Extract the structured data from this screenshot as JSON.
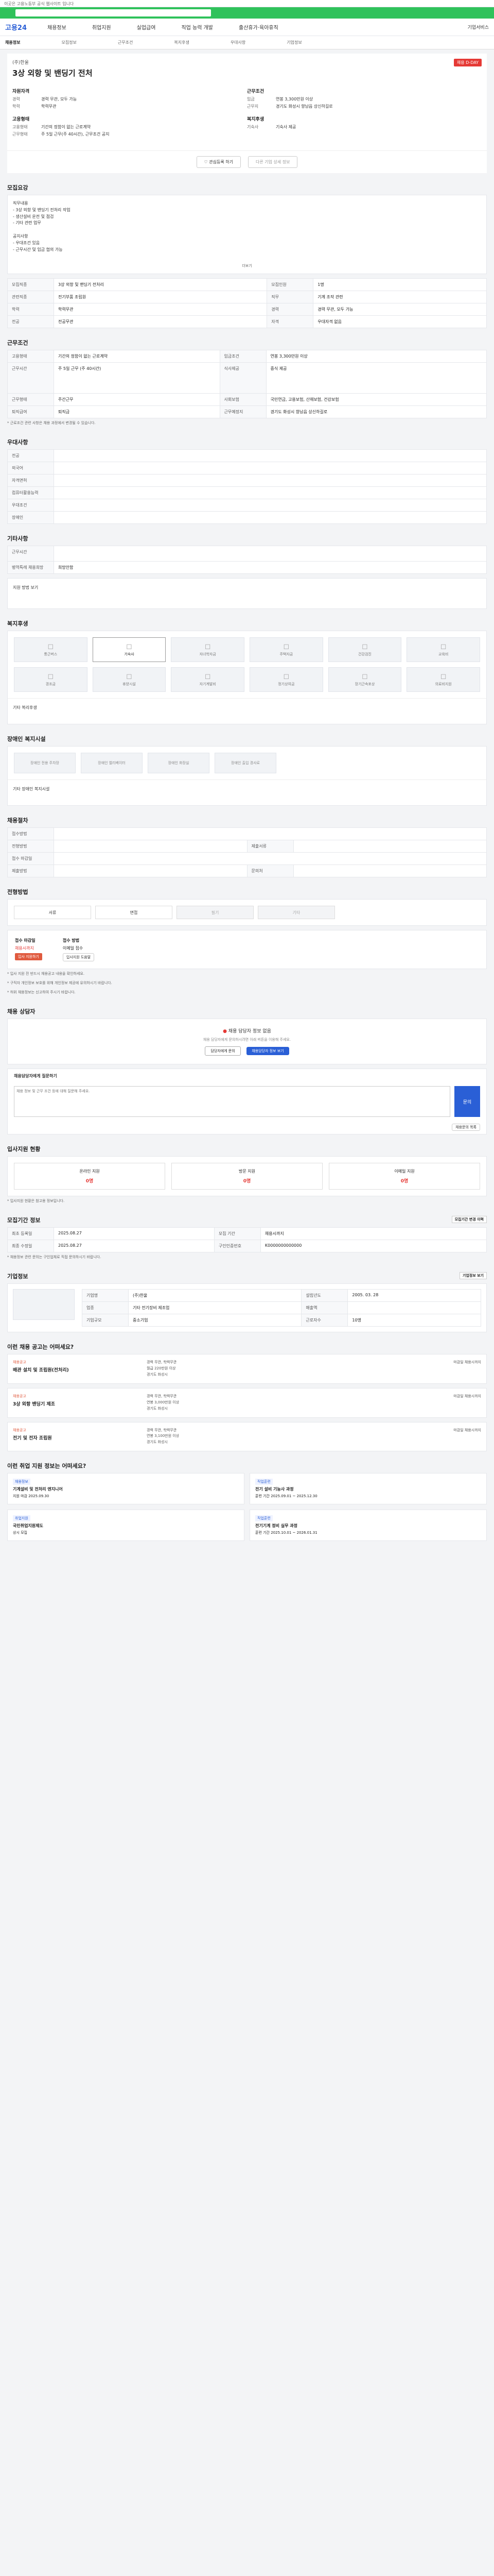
{
  "top": {
    "notice": "이곳은 고용노동부 공식 웹사이트 입니다"
  },
  "gnb": {
    "logo": "고용24",
    "menu": [
      "채용정보",
      "취업지원",
      "실업급여",
      "직업 능력 개발",
      "출산휴가·육아휴직"
    ],
    "right": "기업서비스"
  },
  "subnav": [
    "채용정보",
    "모집정보",
    "근무조건",
    "복지후생",
    "우대사항",
    "기업정보"
  ],
  "headline": {
    "company": "(주)한울",
    "title": "3상 외항 및 밴딩기 전처",
    "badge": "채용 D-DAY"
  },
  "summary": {
    "left": [
      {
        "group": "자원자격",
        "rows": [
          {
            "k": "경력",
            "v": "경력 무관, 모두 가능"
          },
          {
            "k": "학력",
            "v": "학력무관"
          }
        ]
      },
      {
        "group": "고용형태",
        "rows": [
          {
            "k": "고용형태",
            "v": "기간의 정함이 없는 근로계약"
          },
          {
            "k": "근무형태",
            "v": "주 5일 근무(주 40시간), 근무조건 공지"
          }
        ]
      }
    ],
    "right": [
      {
        "group": "근무조건",
        "rows": [
          {
            "k": "임금",
            "v": "연봉 3,300만원 이상"
          },
          {
            "k": "근무지",
            "v": "경기도 화성시 향남읍 상신하길로"
          }
        ]
      },
      {
        "group": "복지후생",
        "rows": [
          {
            "k": "기숙사",
            "v": "기숙사 제공"
          }
        ]
      }
    ],
    "save_btn": "관심등록 하기",
    "share_btn": "다른 기업 상세 정보"
  },
  "recruit": {
    "title": "모집요강",
    "desc_lines": [
      "직무내용",
      "- 3상 외항 및 밴딩기 전처리 작업",
      "- 생산설비 운전 및 점검",
      "- 기타 관련 업무",
      "",
      "공지사항",
      "- 우대조건 있음",
      "- 근무시간 및 임금 협의 가능"
    ],
    "more": "더보기",
    "table": [
      [
        {
          "h": "모집직종"
        },
        {
          "v": "3상 외항 및 밴딩기 전처리"
        },
        {
          "h": "모집인원"
        },
        {
          "v": "1명"
        }
      ],
      [
        {
          "h": "관련직종"
        },
        {
          "v": "전기부품 조립원"
        },
        {
          "h": "직무"
        },
        {
          "v": "기계 조작 관련"
        }
      ],
      [
        {
          "h": "학력"
        },
        {
          "v": "학력무관"
        },
        {
          "h": "경력"
        },
        {
          "v": "경력 무관, 모두 가능"
        }
      ],
      [
        {
          "h": "전공"
        },
        {
          "v": "전공무관"
        },
        {
          "h": "자격"
        },
        {
          "v": "우대자격 없음"
        }
      ]
    ]
  },
  "conditions": {
    "title": "근무조건",
    "rows": [
      [
        {
          "h": "고용형태"
        },
        {
          "v": "기간의 정함이 없는 근로계약"
        },
        {
          "h": "임금조건"
        },
        {
          "v": "연봉 3,300만원 이상"
        }
      ],
      [
        {
          "h": "근무시간"
        },
        {
          "v": "주 5일 근무 (주 40시간)"
        },
        {
          "h": "식사제공"
        },
        {
          "v": "중식 제공"
        }
      ],
      [
        {
          "h": "근무형태"
        },
        {
          "v": "주간근무"
        },
        {
          "h": "사회보험"
        },
        {
          "v": "국민연금, 고용보험, 산재보험, 건강보험"
        }
      ],
      [
        {
          "h": "퇴직급여"
        },
        {
          "v": "퇴직금"
        },
        {
          "h": "근무예정지"
        },
        {
          "v": "경기도 화성시 향남읍 상신하길로"
        }
      ]
    ],
    "note": "* 근로조건 관련 사항은 채용 과정에서 변경될 수 있습니다."
  },
  "prefer": {
    "title": "우대사항",
    "rows": [
      [
        {
          "h": "전공"
        },
        {
          "v": ""
        }
      ],
      [
        {
          "h": "외국어"
        },
        {
          "v": ""
        }
      ],
      [
        {
          "h": "자격면허"
        },
        {
          "v": ""
        }
      ],
      [
        {
          "h": "컴퓨터활용능력"
        },
        {
          "v": ""
        }
      ],
      [
        {
          "h": "우대조건"
        },
        {
          "v": ""
        }
      ],
      [
        {
          "h": "장애인"
        },
        {
          "v": ""
        }
      ]
    ]
  },
  "extra": {
    "title": "기타사항",
    "rows": [
      [
        {
          "h": "근무시간"
        },
        {
          "v": ""
        }
      ],
      [
        {
          "h": "병역특례 채용희망"
        },
        {
          "v": "희망안함"
        }
      ]
    ],
    "link": "지원 방법 보기"
  },
  "welfare": {
    "title": "복지후생",
    "items": [
      "통근버스",
      "기숙사",
      "자녀학자금",
      "주택자금",
      "건강검진",
      "교육비",
      "경조금",
      "휴양시설",
      "자기계발비",
      "정기상여금",
      "장기근속포상",
      "의료비지원"
    ],
    "on_index": 1,
    "note": "기타 복리후생"
  },
  "disabled": {
    "title": "장애인 복지시설",
    "items": [
      "장애인 전용 주차장",
      "장애인 엘리베이터",
      "장애인 화장실",
      "장애인 출입 경사로"
    ],
    "note": "기타 장애인 복지시설"
  },
  "process": {
    "title": "채용절차",
    "rows": [
      [
        {
          "h": "접수방법"
        },
        {
          "v": ""
        },
        {
          "h": ""
        },
        {
          "v": ""
        }
      ],
      [
        {
          "h": "전형방법"
        },
        {
          "v": ""
        },
        {
          "h": "제출서류"
        },
        {
          "v": ""
        }
      ],
      [
        {
          "h": "접수 마감일"
        },
        {
          "v": ""
        },
        {
          "h": ""
        },
        {
          "v": ""
        }
      ],
      [
        {
          "h": "제출방법"
        },
        {
          "v": ""
        },
        {
          "h": "문의처"
        },
        {
          "v": ""
        }
      ]
    ]
  },
  "apply_method": {
    "title": "전형방법",
    "methods": [
      "서류",
      "면접",
      "필기",
      "기타"
    ],
    "dim": [
      2,
      3
    ],
    "info_left": {
      "t": "접수 마감일",
      "v": "채용시까지",
      "btn": "입사 지원하기"
    },
    "info_right": {
      "t": "접수 방법",
      "v": "이메일 접수",
      "btn": "입사지원 도움말"
    },
    "notes": [
      "* 입사 지원 전 반드시 채용공고 내용을 확인하세요.",
      "* 구직자 개인정보 보호를 위해 개인정보 제공에 유의하시기 바랍니다.",
      "* 허위 채용정보는 신고하여 주시기 바랍니다."
    ]
  },
  "helper": {
    "title": "채용 상담자",
    "q": "채용 담당자 정보 없음",
    "sub": "채용 담당자에게 문의하시려면 아래 버튼을 이용해 주세요.",
    "btn_a": "담당자에게 문의",
    "btn_b": "채용담당자 정보 보기",
    "inquiry_label": "채용담당자에게 질문하기",
    "inquiry_placeholder": "채용 정보 및 근무 조건 등에 대해 질문해 주세요.",
    "send": "문의",
    "btn_c": "채용문의 목록"
  },
  "stats": {
    "title": "입사지원 현황",
    "items": [
      {
        "label": "온라인 지원",
        "n": "0명"
      },
      {
        "label": "방문 지원",
        "n": "0명"
      },
      {
        "label": "이메일 지원",
        "n": "0명"
      }
    ],
    "note": "* 입사지원 현황은 참고용 정보입니다."
  },
  "regist": {
    "title": "모집기간 정보",
    "btn": "모집기간 변경 이력",
    "rows": [
      [
        {
          "h": "최초 등록일"
        },
        {
          "v": "2025.08.27"
        },
        {
          "h": "모집 기간"
        },
        {
          "v": "채용시까지"
        }
      ],
      [
        {
          "h": "최종 수정일"
        },
        {
          "v": "2025.08.27"
        },
        {
          "h": "구인인증번호"
        },
        {
          "v": "K0000000000000"
        }
      ]
    ],
    "note": "* 채용정보 관련 문의는 구인업체로 직접 문의하시기 바랍니다."
  },
  "company": {
    "title": "기업정보",
    "more": "기업정보 보기",
    "rows": [
      [
        {
          "h": "기업명"
        },
        {
          "v": "(주)한울"
        },
        {
          "h": "설립년도"
        },
        {
          "v": "2005. 03. 28"
        }
      ],
      [
        {
          "h": "업종"
        },
        {
          "v": "기타 전기장비 제조업"
        },
        {
          "h": "매출액"
        },
        {
          "v": ""
        }
      ],
      [
        {
          "h": "기업규모"
        },
        {
          "v": "중소기업"
        },
        {
          "h": "근로자수"
        },
        {
          "v": "10명"
        }
      ]
    ]
  },
  "similar": {
    "title": "이런 채용 공고는 어떠세요?",
    "jobs": [
      {
        "corp": "채용공고",
        "title": "배관 설치 및 조립원(전처리)",
        "mid": [
          "경력 무관, 학력무관",
          "월급 220만원 이상",
          "경기도 화성시"
        ],
        "right": "마감일 채용시까지"
      },
      {
        "corp": "채용공고",
        "title": "3상 외항 밴딩기 제조",
        "mid": [
          "경력 무관, 학력무관",
          "연봉 3,000만원 이상",
          "경기도 화성시"
        ],
        "right": "마감일 채용시까지"
      },
      {
        "corp": "채용공고",
        "title": "전기 및 전자 조립원",
        "mid": [
          "경력 무관, 학력무관",
          "연봉 3,100만원 이상",
          "경기도 화성시"
        ],
        "right": "마감일 채용시까지"
      }
    ]
  },
  "services": {
    "title": "이런 취업 지원 정보는 어떠세요?",
    "items": [
      {
        "tag": "채용정보",
        "t": "기계설비 및 전처리 엔지니어",
        "d": "지원 마감 2025.09.30"
      },
      {
        "tag": "직업훈련",
        "t": "전기 설비 기능사 과정",
        "d": "훈련 기간 2025.09.01 ~ 2025.12.30"
      },
      {
        "tag": "취업지원",
        "t": "국민취업지원제도",
        "d": "상시 모집"
      },
      {
        "tag": "직업훈련",
        "t": "전기기계 정비 실무 과정",
        "d": "훈련 기간 2025.10.01 ~ 2026.01.31"
      }
    ]
  }
}
